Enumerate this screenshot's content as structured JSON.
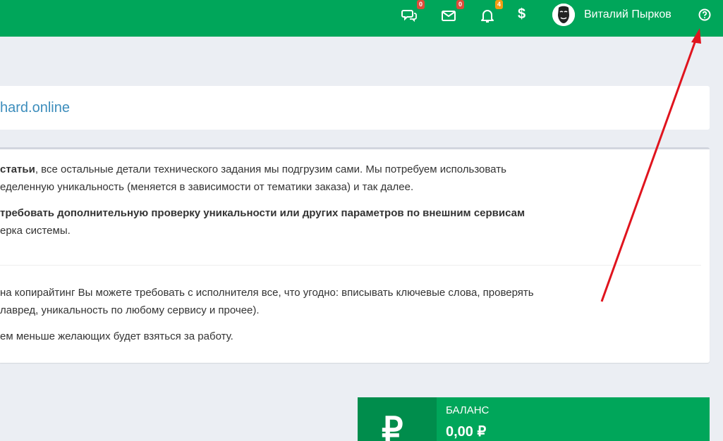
{
  "header": {
    "messages_badge": "0",
    "mail_badge": "0",
    "notifications_badge": "4",
    "currency_symbol": "$",
    "username": "Виталий Пырков"
  },
  "site": {
    "link_text": "hard.online"
  },
  "info": {
    "p1_bold": "статьи",
    "p1_rest": ", все остальные детали технического задания мы подгрузим сами. Мы потребуем использовать",
    "p1_line2": "еделенную уникальность (меняется в зависимости от тематики заказа) и так далее.",
    "p2_bold": "требовать дополнительную проверку уникальности или других параметров по внешним сервисам",
    "p2_line2": "ерка системы.",
    "p3_line1": "на копирайтинг Вы можете требовать с исполнителя все, что угодно: вписывать ключевые слова, проверять",
    "p3_line2": "лавред, уникальность по любому сервису и прочее).",
    "p4": "ем меньше желающих будет взяться за работу."
  },
  "balance": {
    "label": "БАЛАНС",
    "value": "0,00 ₽",
    "icon": "₽"
  },
  "colors": {
    "brand_green": "#00a65a",
    "dark_green": "#008d4c",
    "link_blue": "#3c8dbc",
    "badge_red": "#dd4b39",
    "badge_orange": "#f39c12",
    "annotation_arrow": "#e0141e"
  }
}
